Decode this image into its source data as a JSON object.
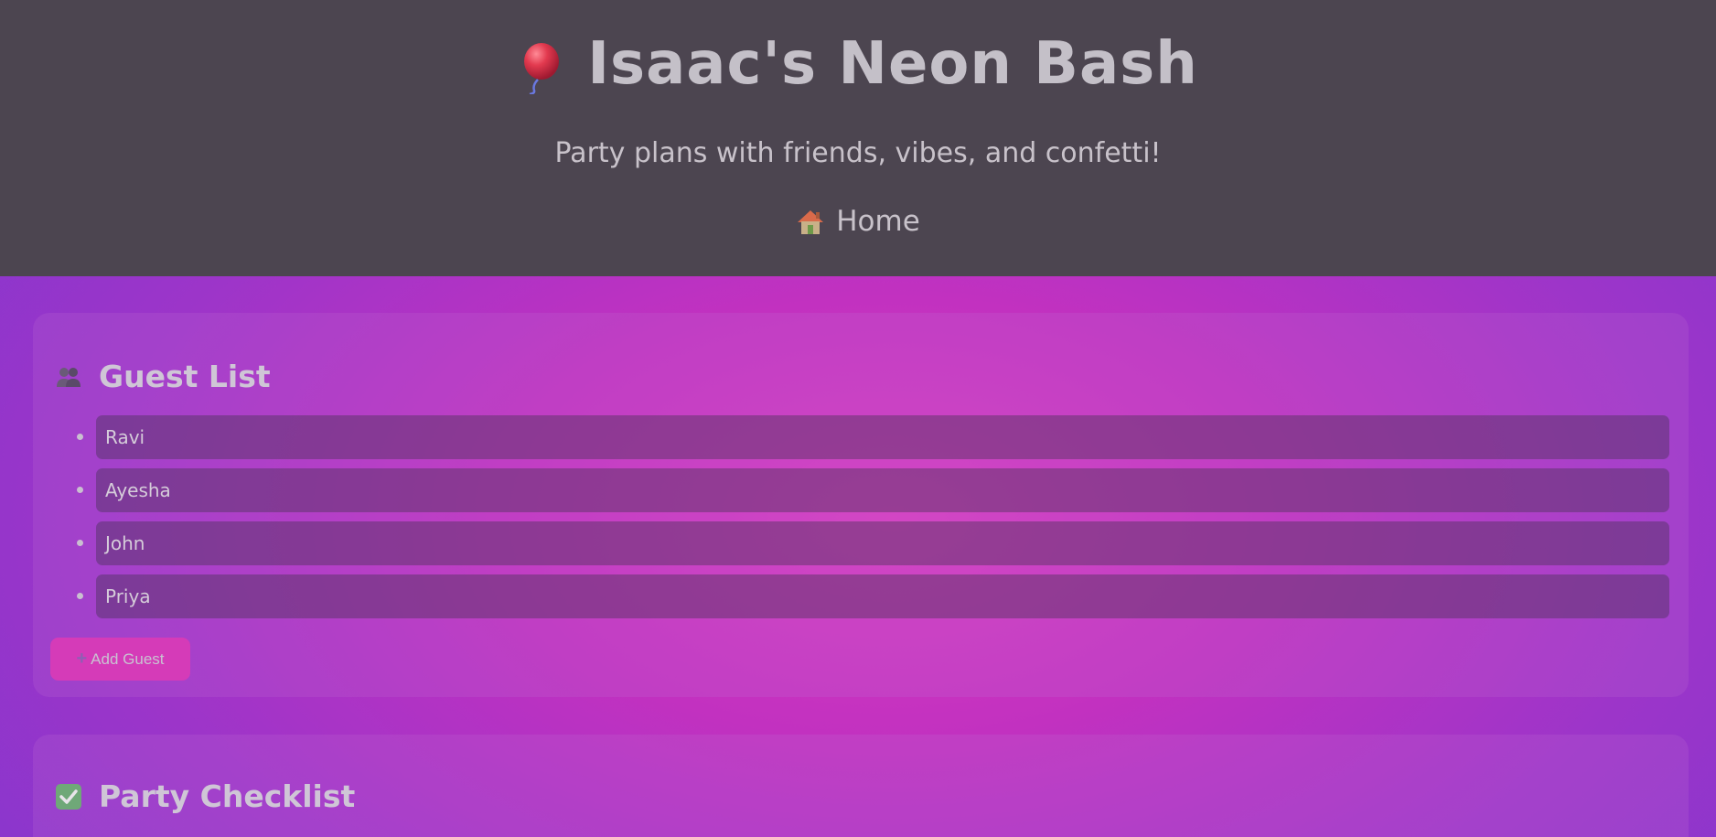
{
  "header": {
    "balloon_icon": "balloon-icon",
    "title": "Isaac's Neon Bash",
    "tagline": "Party plans with friends, vibes, and confetti!",
    "nav_home_icon": "house-icon",
    "nav_home_label": "Home"
  },
  "guest_section": {
    "icon": "people-icon",
    "title": "Guest List",
    "guests": [
      "Ravi",
      "Ayesha",
      "John",
      "Priya"
    ],
    "add_button_icon": "plus-icon",
    "add_button_label": "Add Guest"
  },
  "checklist_section": {
    "icon": "checkmark-box-icon",
    "title": "Party Checklist"
  },
  "colors": {
    "header_bg": "#4c4550",
    "accent_pink": "#d53bb8",
    "bg_purple": "#7d36cf",
    "bg_magenta": "#d93cc0"
  }
}
